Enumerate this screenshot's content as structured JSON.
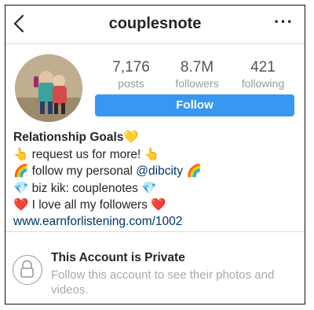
{
  "header": {
    "username": "couplesnote",
    "back_icon": "chevron-left-icon",
    "more_label": "···"
  },
  "profile": {
    "avatar_desc": "avatar",
    "stats": [
      {
        "value": "7,176",
        "label": "posts"
      },
      {
        "value": "8.7M",
        "label": "followers"
      },
      {
        "value": "421",
        "label": "following"
      }
    ],
    "follow_label": "Follow",
    "accent_color": "#3897f0"
  },
  "bio": {
    "name": "Relationship Goals",
    "name_emoji": "💛",
    "lines": [
      {
        "pre": "👆",
        "text": " request us for more! ",
        "post": "👆"
      },
      {
        "pre": "🌈",
        "text": " follow my personal ",
        "tag": "@dibcity",
        "post": " 🌈"
      },
      {
        "pre": "💎",
        "text": " biz kik: couplenotes ",
        "post": "💎"
      },
      {
        "pre": "❤️",
        "text": " I love all my followers ",
        "post": "❤️"
      }
    ],
    "website": "www.earnforlistening.com/1002"
  },
  "private": {
    "title": "This Account is Private",
    "subtitle": "Follow this account to see their photos and videos.",
    "icon": "lock-icon"
  }
}
